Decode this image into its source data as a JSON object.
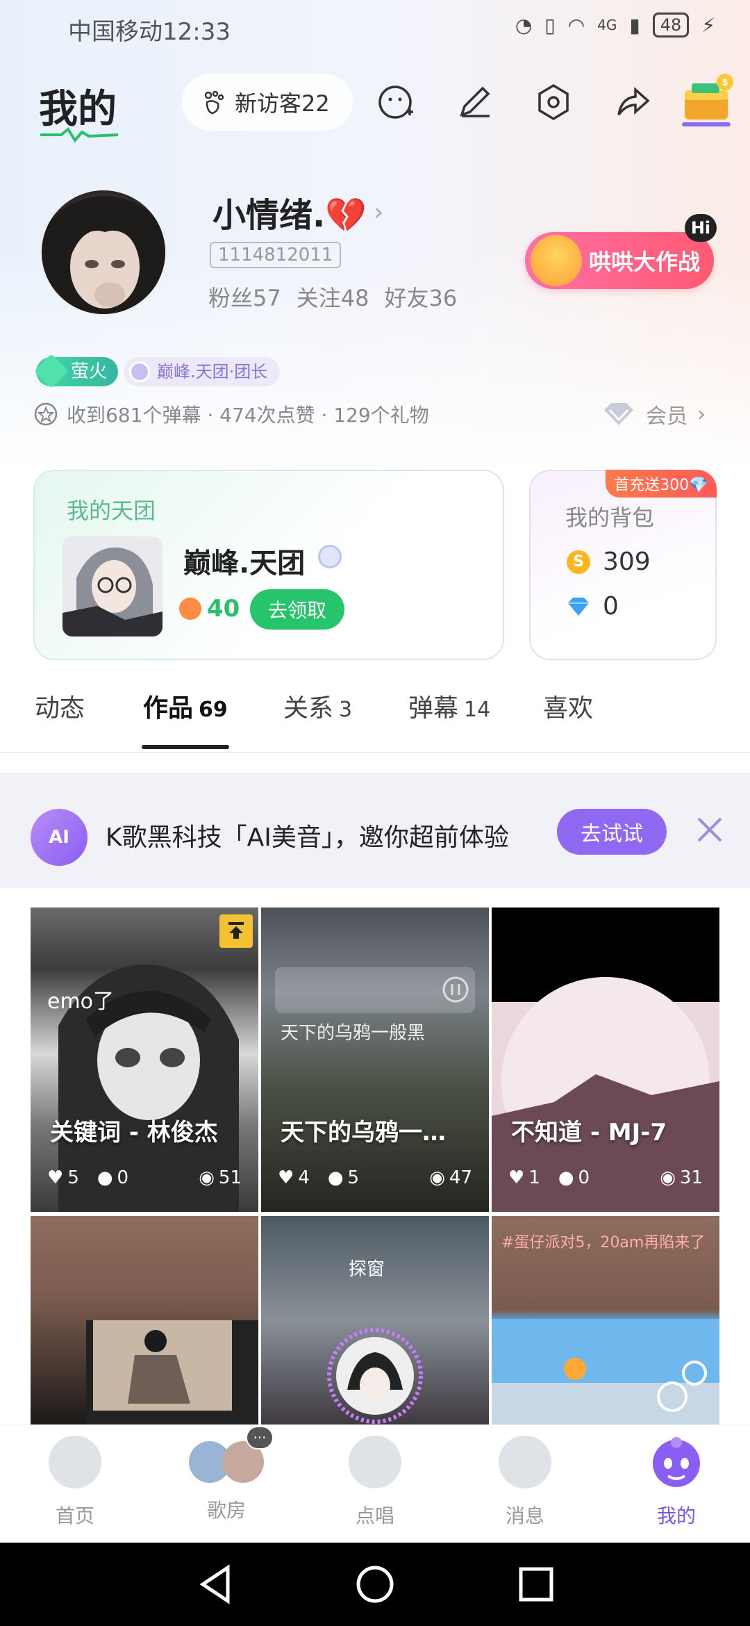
{
  "status_bar": {
    "carrier_time": "中国移动12:33",
    "network": "4G",
    "battery": "48"
  },
  "header": {
    "title": "我的",
    "visitor_label": "新访客22"
  },
  "profile": {
    "nickname": "小情绪.💔",
    "uid": "1114812011",
    "stats": {
      "fans": "粉丝57",
      "following": "关注48",
      "friends": "好友36"
    },
    "game_button": "哄哄大作战",
    "game_badge": "Hi",
    "tags": {
      "fire": "萤火",
      "group": "巅峰.天团·团长"
    },
    "received": "收到681个弹幕 · 474次点赞 · 129个礼物",
    "member": "会员"
  },
  "group_card": {
    "title": "我的天团",
    "name": "巅峰.天团",
    "level": "40",
    "claim": "去领取"
  },
  "bag_card": {
    "promo": "首充送300💎",
    "title": "我的背包",
    "coins": "309",
    "diamonds": "0"
  },
  "tabs": [
    {
      "label": "动态",
      "count": ""
    },
    {
      "label": "作品",
      "count": "69"
    },
    {
      "label": "关系",
      "count": "3"
    },
    {
      "label": "弹幕",
      "count": "14"
    },
    {
      "label": "喜欢",
      "count": ""
    }
  ],
  "banner": {
    "logo": "AI",
    "text": "K歌黑科技「AI美音」，邀你超前体验",
    "button": "去试试"
  },
  "works": [
    {
      "title": "关键词 - 林俊杰",
      "tag": "emo了",
      "likes": "5",
      "comments": "0",
      "views": "51"
    },
    {
      "title": "天下的乌鸦一…",
      "tag": "天下的乌鸦一般黑",
      "likes": "4",
      "comments": "5",
      "views": "47"
    },
    {
      "title": "不知道 - MJ-7",
      "tag": "",
      "likes": "1",
      "comments": "0",
      "views": "31"
    },
    {
      "title": "",
      "tag": "",
      "likes": "",
      "comments": "",
      "views": ""
    },
    {
      "title": "",
      "tag": "探窗",
      "likes": "",
      "comments": "",
      "views": ""
    },
    {
      "title": "",
      "tag": "#蛋仔派对5，20am再陷来了",
      "likes": "",
      "comments": "",
      "views": ""
    }
  ],
  "bottom_nav": [
    {
      "label": "首页"
    },
    {
      "label": "歌房"
    },
    {
      "label": "点唱"
    },
    {
      "label": "消息"
    },
    {
      "label": "我的"
    }
  ],
  "colors": {
    "accent": "#7b55e6",
    "green": "#27c56b",
    "pink": "#ff5a73"
  }
}
